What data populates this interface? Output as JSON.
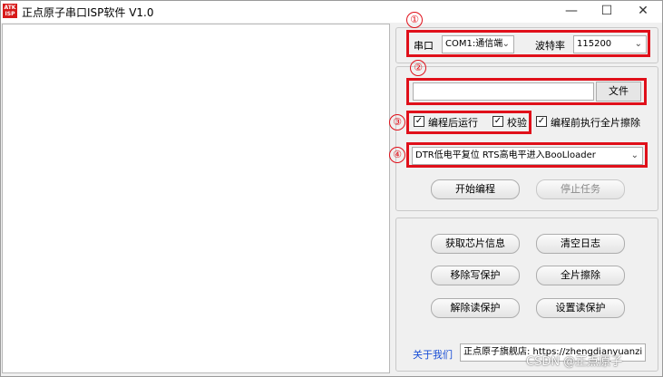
{
  "window": {
    "title": "正点原子串口ISP软件 V1.0",
    "minimize": "—",
    "maximize": "☐",
    "close": "✕",
    "icon_text": "ATK ISP"
  },
  "markers": [
    "①",
    "②",
    "③",
    "④"
  ],
  "serial": {
    "port_label": "串口",
    "port_value": "COM1:通信端",
    "baud_label": "波特率",
    "baud_value": "115200"
  },
  "file": {
    "path_value": "",
    "file_button": "文件"
  },
  "options": {
    "run_after_program": "编程后运行",
    "verify": "校验",
    "erase_before": "编程前执行全片擦除",
    "checked_mark": "✓"
  },
  "boot_mode": {
    "value": "DTR低电平复位 RTS高电平进入BooLloader"
  },
  "actions": {
    "start_program": "开始编程",
    "stop_task": "停止任务"
  },
  "tools": {
    "get_chip_info": "获取芯片信息",
    "clear_log": "清空日志",
    "remove_write_protect": "移除写保护",
    "full_erase": "全片擦除",
    "remove_read_protect": "解除读保护",
    "set_read_protect": "设置读保护"
  },
  "footer": {
    "about": "关于我们",
    "store": "正点原子旗舰店: https://zhengdianyuanzi"
  },
  "watermark": "CSDN @正点原子",
  "colors": {
    "highlight": "#e0101a",
    "link": "#1a4fd6"
  }
}
